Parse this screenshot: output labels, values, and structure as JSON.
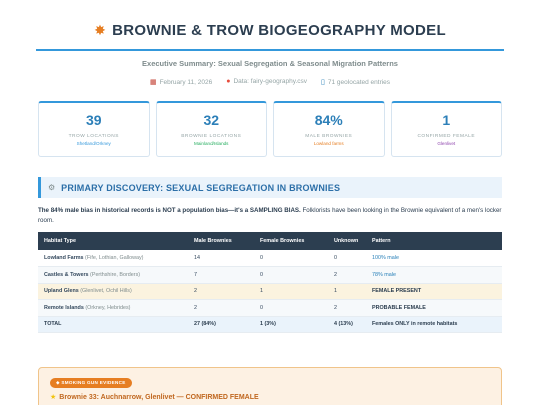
{
  "header": {
    "icon": "fairy-icon",
    "title": "BROWNIE & TROW BIOGEOGRAPHY MODEL",
    "subtitle": "Executive Summary: Sexual Segregation & Seasonal Migration Patterns",
    "meta": {
      "date": "February 11, 2026",
      "data_source": "Data: fairy-geography.csv",
      "entries": "71 geolocated entries"
    }
  },
  "stats": [
    {
      "value": "39",
      "label": "TROW LOCATIONS",
      "sub": "Shetland/Orkney",
      "color": "#3498db"
    },
    {
      "value": "32",
      "label": "BROWNIE LOCATIONS",
      "sub": "Mainland/Islands",
      "color": "#27ae60"
    },
    {
      "value": "84%",
      "label": "MALE BROWNIES",
      "sub": "Lowland farms",
      "color": "#e67e22"
    },
    {
      "value": "1",
      "label": "CONFIRMED FEMALE",
      "sub": "Glenlivet",
      "color": "#8e44ad"
    }
  ],
  "section": {
    "icon": "microscope-icon",
    "title": "PRIMARY DISCOVERY: SEXUAL SEGREGATION IN BROWNIES"
  },
  "lead": {
    "bold": "The 84% male bias in historical records is NOT a population bias—it's a SAMPLING BIAS.",
    "rest": " Folklorists have been looking in the Brownie equivalent of a men's locker room."
  },
  "table": {
    "headers": [
      "Habitat Type",
      "Male Brownies",
      "Female Brownies",
      "Unknown",
      "Pattern"
    ],
    "rows": [
      {
        "habitat": "Lowland Farms",
        "region": "(Fife, Lothian, Galloway)",
        "male": "14",
        "female": "0",
        "unknown": "0",
        "pattern": "100% male"
      },
      {
        "habitat": "Castles & Towers",
        "region": "(Perthshire, Borders)",
        "male": "7",
        "female": "0",
        "unknown": "2",
        "pattern": "78% male"
      },
      {
        "habitat": "Upland Glens",
        "region": "(Glenlivet, Ochil Hills)",
        "male": "2",
        "female": "1",
        "unknown": "1",
        "pattern": "FEMALE PRESENT"
      },
      {
        "habitat": "Remote Islands",
        "region": "(Orkney, Hebrides)",
        "male": "2",
        "female": "0",
        "unknown": "2",
        "pattern": "PROBABLE FEMALE"
      }
    ],
    "total": {
      "habitat": "TOTAL",
      "male": "27 (84%)",
      "female": "1 (3%)",
      "unknown": "4 (13%)",
      "pattern": "Females ONLY in remote habitats"
    }
  },
  "evidence": {
    "badge": "SMOKING GUN EVIDENCE",
    "line": "Brownie 33: Auchnarrow, Glenlivet — CONFIRMED FEMALE"
  }
}
